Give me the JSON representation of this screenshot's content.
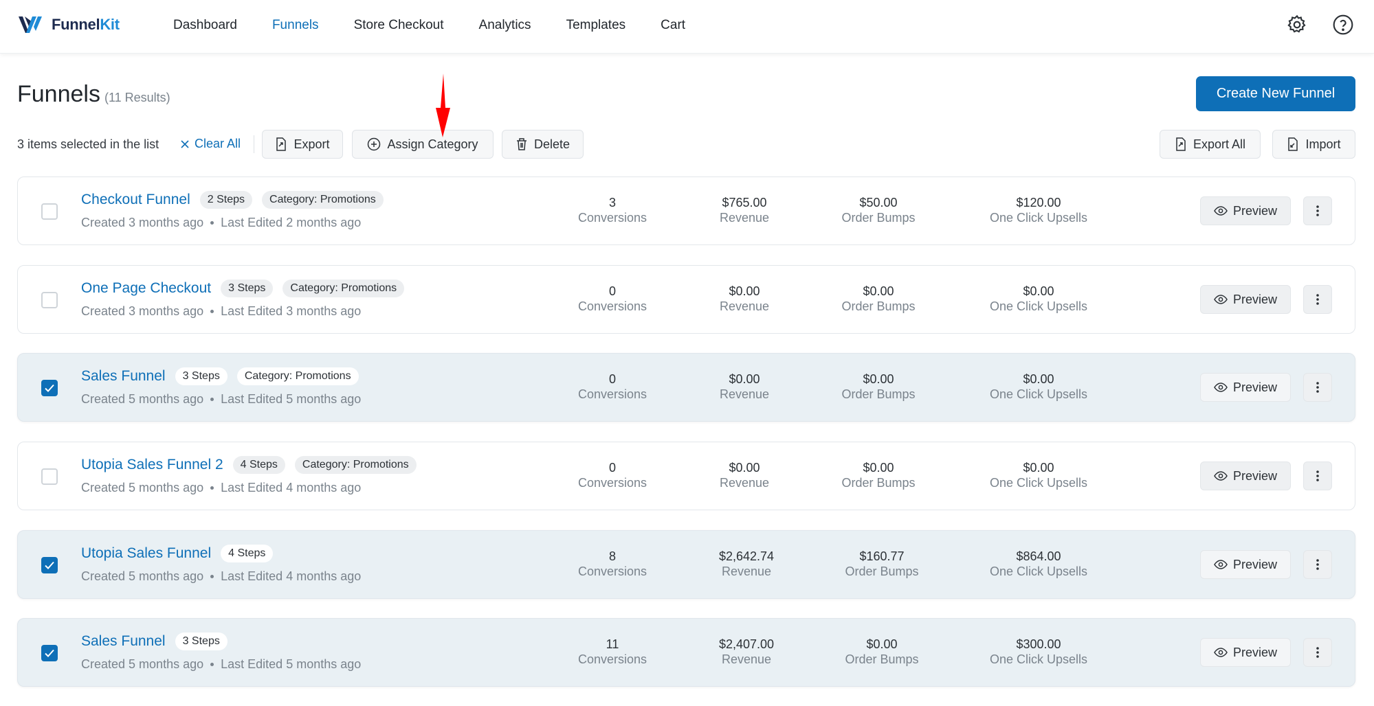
{
  "nav": {
    "logo": {
      "main": "Funnel",
      "accent": "Kit"
    },
    "items": [
      {
        "label": "Dashboard",
        "active": false
      },
      {
        "label": "Funnels",
        "active": true
      },
      {
        "label": "Store Checkout",
        "active": false
      },
      {
        "label": "Analytics",
        "active": false
      },
      {
        "label": "Templates",
        "active": false
      },
      {
        "label": "Cart",
        "active": false
      }
    ],
    "icons": [
      "gear-icon",
      "help-icon"
    ]
  },
  "header": {
    "title": "Funnels",
    "results": "(11 Results)",
    "create_label": "Create New Funnel"
  },
  "toolbar": {
    "selected_text": "3 items selected in the list",
    "clear_all": "Clear All",
    "export": "Export",
    "assign_category": "Assign Category",
    "delete": "Delete",
    "export_all": "Export All",
    "import": "Import"
  },
  "colors": {
    "accent": "#0e6fb7",
    "annotation_arrow": "#ff0000"
  },
  "funnels": [
    {
      "name": "Checkout Funnel",
      "steps": "2 Steps",
      "category": "Category: Promotions",
      "created": "Created 3 months ago",
      "edited": "Last Edited 2 months ago",
      "conversions": "3",
      "revenue": "$765.00",
      "order_bumps": "$50.00",
      "upsells": "$120.00",
      "selected": false
    },
    {
      "name": "One Page Checkout",
      "steps": "3 Steps",
      "category": "Category: Promotions",
      "created": "Created 3 months ago",
      "edited": "Last Edited 3 months ago",
      "conversions": "0",
      "revenue": "$0.00",
      "order_bumps": "$0.00",
      "upsells": "$0.00",
      "selected": false
    },
    {
      "name": "Sales Funnel",
      "steps": "3 Steps",
      "category": "Category: Promotions",
      "created": "Created 5 months ago",
      "edited": "Last Edited 5 months ago",
      "conversions": "0",
      "revenue": "$0.00",
      "order_bumps": "$0.00",
      "upsells": "$0.00",
      "selected": true
    },
    {
      "name": "Utopia Sales Funnel 2",
      "steps": "4 Steps",
      "category": "Category: Promotions",
      "created": "Created 5 months ago",
      "edited": "Last Edited 4 months ago",
      "conversions": "0",
      "revenue": "$0.00",
      "order_bumps": "$0.00",
      "upsells": "$0.00",
      "selected": false
    },
    {
      "name": "Utopia Sales Funnel",
      "steps": "4 Steps",
      "category": "",
      "created": "Created 5 months ago",
      "edited": "Last Edited 4 months ago",
      "conversions": "8",
      "revenue": "$2,642.74",
      "order_bumps": "$160.77",
      "upsells": "$864.00",
      "selected": true
    },
    {
      "name": "Sales Funnel",
      "steps": "3 Steps",
      "category": "",
      "created": "Created 5 months ago",
      "edited": "Last Edited 5 months ago",
      "conversions": "11",
      "revenue": "$2,407.00",
      "order_bumps": "$0.00",
      "upsells": "$300.00",
      "selected": true
    }
  ],
  "labels": {
    "conversions": "Conversions",
    "revenue": "Revenue",
    "order_bumps": "Order Bumps",
    "upsells": "One Click Upsells",
    "preview": "Preview"
  }
}
